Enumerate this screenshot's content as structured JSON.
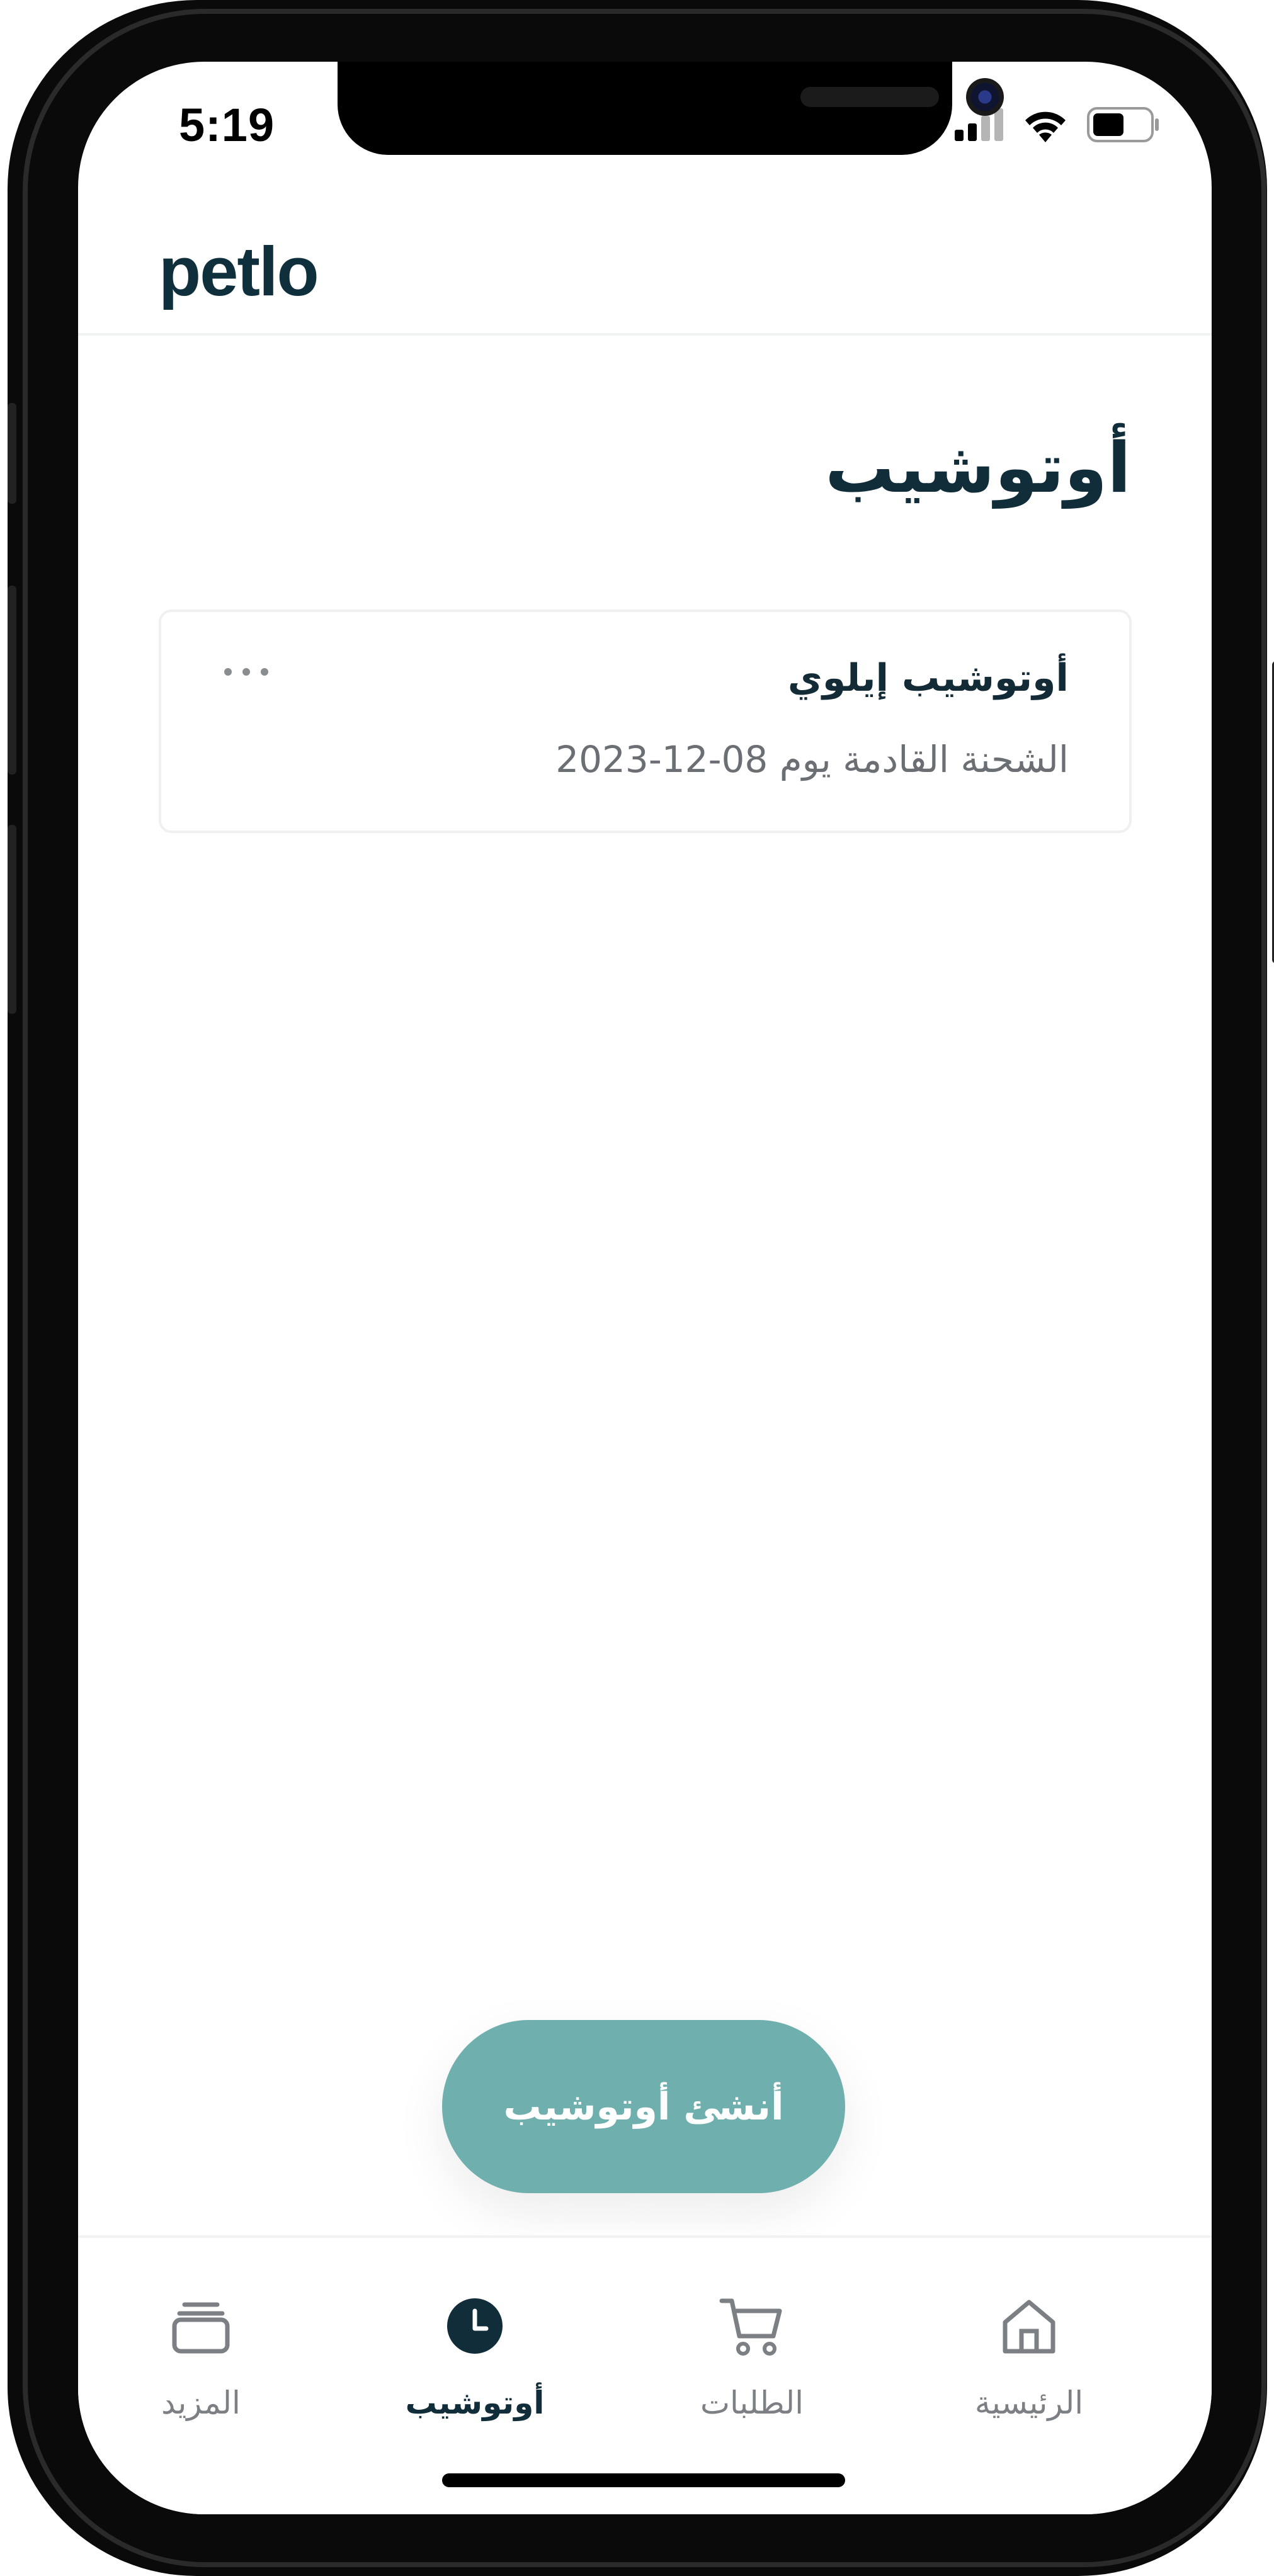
{
  "status_bar": {
    "time": "5:19"
  },
  "header": {
    "logo": "petlo"
  },
  "main": {
    "title": "أوتوشيب",
    "card": {
      "title": "أوتوشيب إيلوي",
      "subtitle": "الشحنة القادمة يوم 08-12-2023"
    },
    "create_button_label": "أنشئ أوتوشيب"
  },
  "bottom_nav": {
    "items": [
      {
        "label": "الرئيسية",
        "icon": "home-icon"
      },
      {
        "label": "الطلبات",
        "icon": "cart-icon"
      },
      {
        "label": "أوتوشيب",
        "icon": "clock-icon",
        "active": true
      },
      {
        "label": "المزيد",
        "icon": "stack-icon"
      }
    ]
  },
  "colors": {
    "brand_dark": "#102d39",
    "accent_teal": "#6fafae",
    "muted_text": "#7c7f83"
  }
}
